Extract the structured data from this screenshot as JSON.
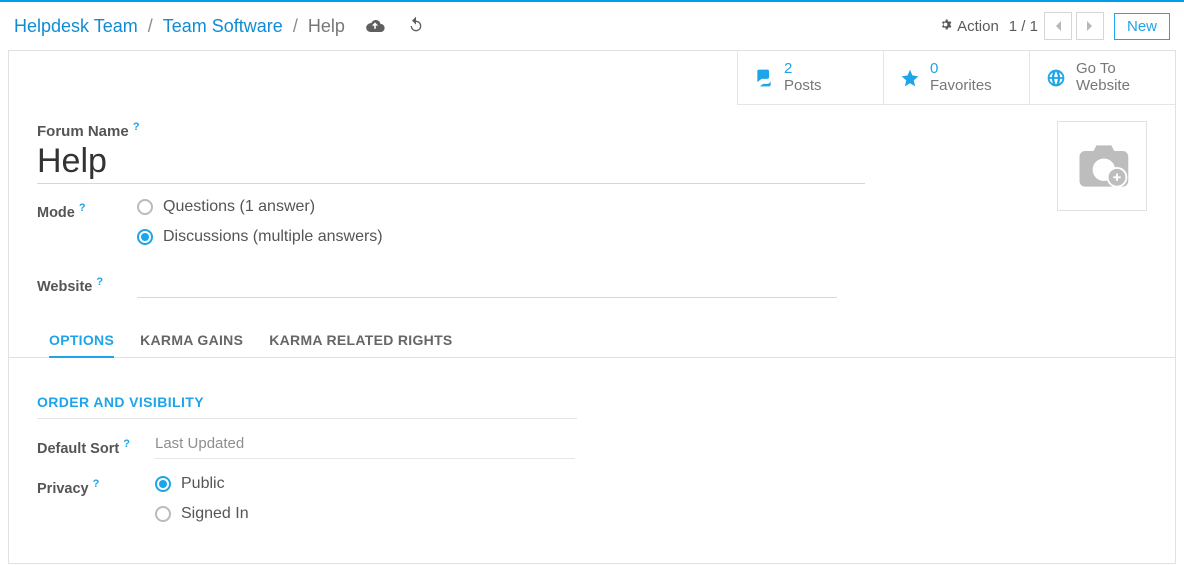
{
  "breadcrumb": {
    "root": "Helpdesk Team",
    "mid": "Team Software",
    "current": "Help"
  },
  "topbar": {
    "action_label": "Action",
    "pager": "1 / 1",
    "new_label": "New"
  },
  "stats": {
    "posts": {
      "value": "2",
      "label": "Posts"
    },
    "favorites": {
      "value": "0",
      "label": "Favorites"
    },
    "website": {
      "line1": "Go To",
      "line2": "Website"
    }
  },
  "form": {
    "forum_name_label": "Forum Name",
    "forum_name_value": "Help",
    "mode_label": "Mode",
    "mode_options": {
      "q": "Questions (1 answer)",
      "d": "Discussions (multiple answers)"
    },
    "website_label": "Website"
  },
  "tabs": {
    "options": "OPTIONS",
    "karma_gains": "KARMA GAINS",
    "karma_rights": "KARMA RELATED RIGHTS"
  },
  "options_section": {
    "title": "ORDER AND VISIBILITY",
    "default_sort_label": "Default Sort",
    "default_sort_value": "Last Updated",
    "privacy_label": "Privacy",
    "privacy_options": {
      "public": "Public",
      "signed": "Signed In"
    }
  }
}
